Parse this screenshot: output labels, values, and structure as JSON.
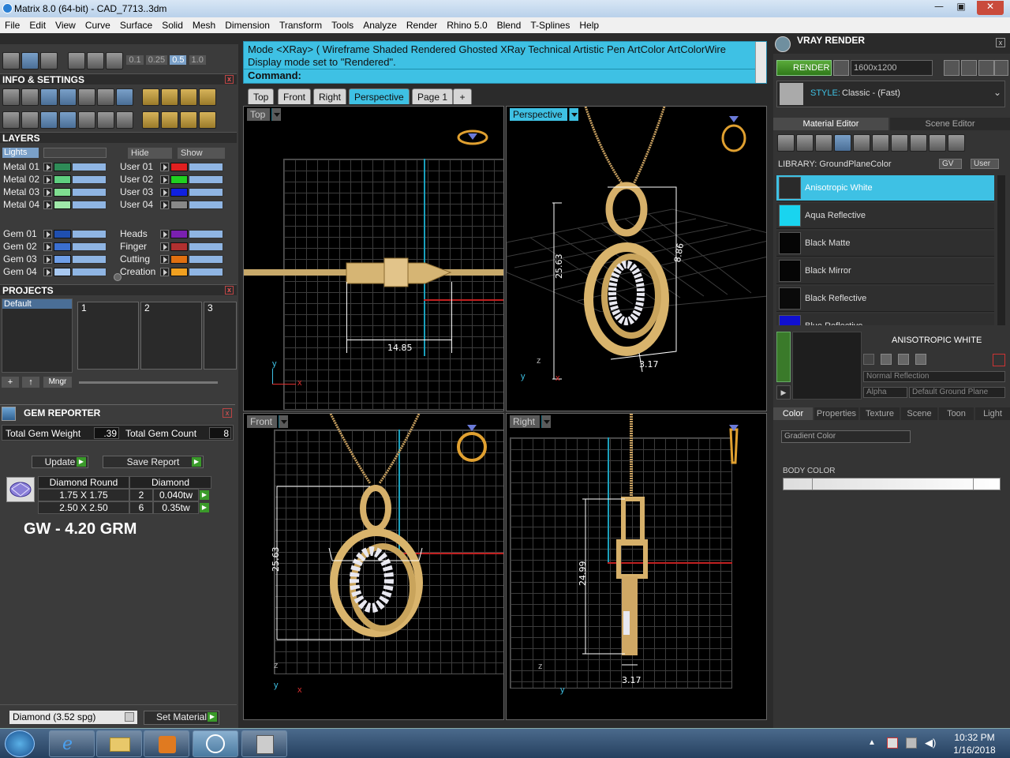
{
  "window": {
    "title": "Matrix 8.0 (64-bit) - CAD_7713..3dm",
    "min": "—",
    "max": "▣",
    "close": "✕"
  },
  "menu": [
    "File",
    "Edit",
    "View",
    "Curve",
    "Surface",
    "Solid",
    "Mesh",
    "Dimension",
    "Transform",
    "Tools",
    "Analyze",
    "Render",
    "Rhino 5.0",
    "Blend",
    "T-Splines",
    "Help"
  ],
  "toolbar": {
    "values": [
      "0.1",
      "0.25",
      "0.5",
      "1.0"
    ]
  },
  "info": {
    "title": "INFO & SETTINGS"
  },
  "layers": {
    "title": "LAYERS",
    "lights_label": "Lights",
    "hide_label": "Hide",
    "show_label": "Show",
    "left": [
      {
        "name": "Metal 01",
        "color": "#2e8b57"
      },
      {
        "name": "Metal 02",
        "color": "#5fcf80"
      },
      {
        "name": "Metal 03",
        "color": "#7fdd90"
      },
      {
        "name": "Metal 04",
        "color": "#9fe8a8"
      },
      {
        "name": "Gem 01",
        "color": "#1f4fb0"
      },
      {
        "name": "Gem 02",
        "color": "#3b6fd0"
      },
      {
        "name": "Gem 03",
        "color": "#6f9fe8"
      },
      {
        "name": "Gem 04",
        "color": "#a8c8f0"
      }
    ],
    "right": [
      {
        "name": "User 01",
        "color": "#e02020"
      },
      {
        "name": "User 02",
        "color": "#20d020"
      },
      {
        "name": "User 03",
        "color": "#1020e0"
      },
      {
        "name": "User 04",
        "color": "#888888"
      },
      {
        "name": "Heads",
        "color": "#7a20b0"
      },
      {
        "name": "Finger",
        "color": "#b03030"
      },
      {
        "name": "Cutting",
        "color": "#e07010"
      },
      {
        "name": "Creation",
        "color": "#f0a020"
      }
    ]
  },
  "projects": {
    "title": "PROJECTS",
    "default": "Default",
    "slots": [
      "1",
      "2",
      "3"
    ],
    "mngr": "Mngr"
  },
  "gem": {
    "title": "GEM REPORTER",
    "weight_label": "Total Gem Weight",
    "weight": ".39",
    "count_label": "Total Gem Count",
    "count": "8",
    "update": "Update",
    "save": "Save Report",
    "header": [
      "Diamond Round",
      "Diamond"
    ],
    "rows": [
      {
        "size": "1.75 X 1.75",
        "qty": "2",
        "tw": "0.040tw"
      },
      {
        "size": "2.50 X 2.50",
        "qty": "6",
        "tw": "0.35tw"
      }
    ],
    "gw": "GW - 4.20 GRM",
    "material": "Diamond      (3.52 spg)",
    "set_material": "Set Material"
  },
  "command": {
    "line1": "Mode <XRay> ( Wireframe  Shaded  Rendered  Ghosted  XRay  Technical  Artistic  Pen  ArtColor  ArtColorWire",
    "line2": "Display mode set to \"Rendered\".",
    "prompt": "Command:"
  },
  "tabs": [
    "Top",
    "Front",
    "Right",
    "Perspective",
    "Page 1",
    "+"
  ],
  "viewports": {
    "top": "Top",
    "perspective": "Perspective",
    "front": "Front",
    "right": "Right"
  },
  "dims": {
    "top_width": "14.85",
    "persp_height": "25.63",
    "persp_depth": "3.17",
    "persp_side": "8.86",
    "front_height": "25.63",
    "right_height": "24.99",
    "right_depth": "3.17"
  },
  "axes": {
    "x": "x",
    "y": "y",
    "z": "z"
  },
  "vray": {
    "title": "VRAY RENDER",
    "render": "RENDER",
    "resolution": "1600x1200",
    "style_label": "STYLE:",
    "style": "Classic - (Fast)",
    "tabs": [
      "Material Editor",
      "Scene Editor"
    ],
    "library": "LIBRARY: GroundPlaneColor",
    "gv": "GV",
    "user": "User",
    "materials": [
      {
        "name": "Anisotropic White",
        "color": "#2a2a2a"
      },
      {
        "name": "Aqua Reflective",
        "color": "#19d4ef"
      },
      {
        "name": "Black Matte",
        "color": "#050505"
      },
      {
        "name": "Black Mirror",
        "color": "#050505"
      },
      {
        "name": "Black Reflective",
        "color": "#0a0a0a"
      },
      {
        "name": "Blue Reflective",
        "color": "#1010d0"
      }
    ],
    "selected_name": "ANISOTROPIC WHITE",
    "reflection": "Normal Reflection",
    "alpha": "Alpha",
    "ground": "Default Ground Plane",
    "subtabs": [
      "Color",
      "Properties",
      "Texture",
      "Scene",
      "Toon",
      "Light"
    ],
    "gradient": "Gradient Color",
    "body_color": "BODY COLOR"
  },
  "taskbar": {
    "time": "10:32 PM",
    "date": "1/16/2018"
  }
}
